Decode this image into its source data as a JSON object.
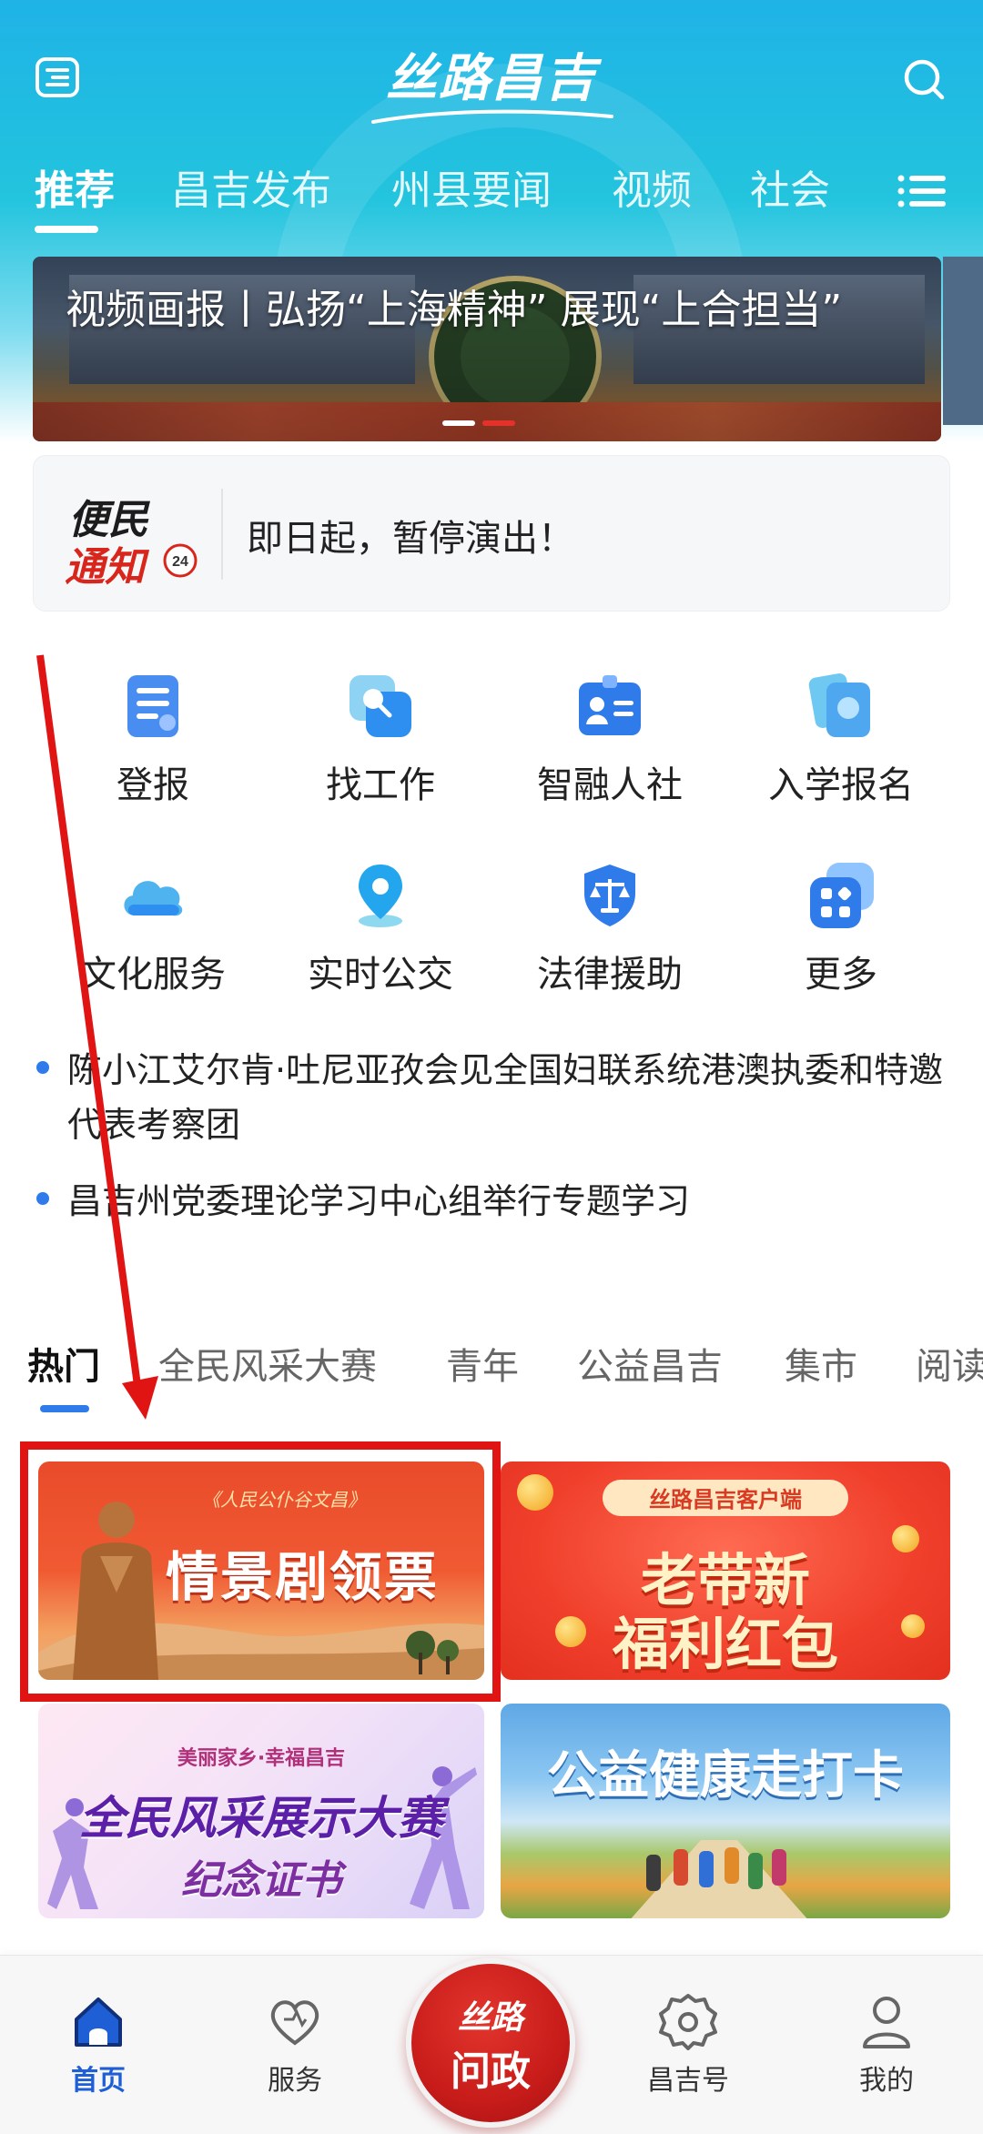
{
  "app": {
    "logo_text": "丝路昌吉",
    "brand_color": "#22b8e3",
    "accent_color": "#2f7be9"
  },
  "header": {
    "menu_icon": "menu-icon",
    "search_icon": "search-icon",
    "channels": [
      "推荐",
      "昌吉发布",
      "州县要闻",
      "视频",
      "社会"
    ],
    "active_channel": "推荐",
    "more_icon": "list-icon"
  },
  "banner": {
    "title": "视频画报丨弘扬“上海精神” 展现“上合担当”",
    "page_count": 2,
    "active_page": 2
  },
  "notice": {
    "badge_line1": "便民",
    "badge_line2": "通知",
    "badge_number": "24",
    "text": "即日起，暂停演出！"
  },
  "services": [
    {
      "label": "登报",
      "icon": "newspaper-icon"
    },
    {
      "label": "找工作",
      "icon": "job-search-icon"
    },
    {
      "label": "智融人社",
      "icon": "id-card-icon"
    },
    {
      "label": "入学报名",
      "icon": "enrollment-icon"
    },
    {
      "label": "文化服务",
      "icon": "cloud-icon"
    },
    {
      "label": "实时公交",
      "icon": "location-pin-icon"
    },
    {
      "label": "法律援助",
      "icon": "scales-shield-icon"
    },
    {
      "label": "更多",
      "icon": "more-apps-icon"
    }
  ],
  "news": [
    "陈小江艾尔肯·吐尼亚孜会见全国妇联系统港澳执委和特邀代表考察团",
    "昌吉州党委理论学习中心组举行专题学习"
  ],
  "categories": [
    "热门",
    "全民风采大赛",
    "青年",
    "公益昌吉",
    "集市",
    "阅读"
  ],
  "active_category": "热门",
  "promos": {
    "p1": {
      "subtitle": "《人民公仆谷文昌》",
      "title": "情景剧领票"
    },
    "p2": {
      "subtitle": "丝路昌吉客户端",
      "title_line1": "老带新",
      "title_line2": "福利红包"
    },
    "p3": {
      "subtitle": "美丽家乡·幸福昌吉",
      "title_line1": "全民风采展示大赛",
      "title_line2": "纪念证书"
    },
    "p4": {
      "title": "公益健康走打卡"
    }
  },
  "bottom_nav": {
    "items": [
      {
        "label": "首页",
        "icon": "home-icon",
        "active": true
      },
      {
        "label": "服务",
        "icon": "heart-icon",
        "active": false
      },
      {
        "label": "昌吉号",
        "icon": "gear-icon",
        "active": false
      },
      {
        "label": "我的",
        "icon": "profile-icon",
        "active": false
      }
    ],
    "center_line1": "丝路",
    "center_line2": "问政",
    "active_color": "#1f5fd6"
  },
  "annotation": {
    "highlight_color": "#e11414"
  }
}
